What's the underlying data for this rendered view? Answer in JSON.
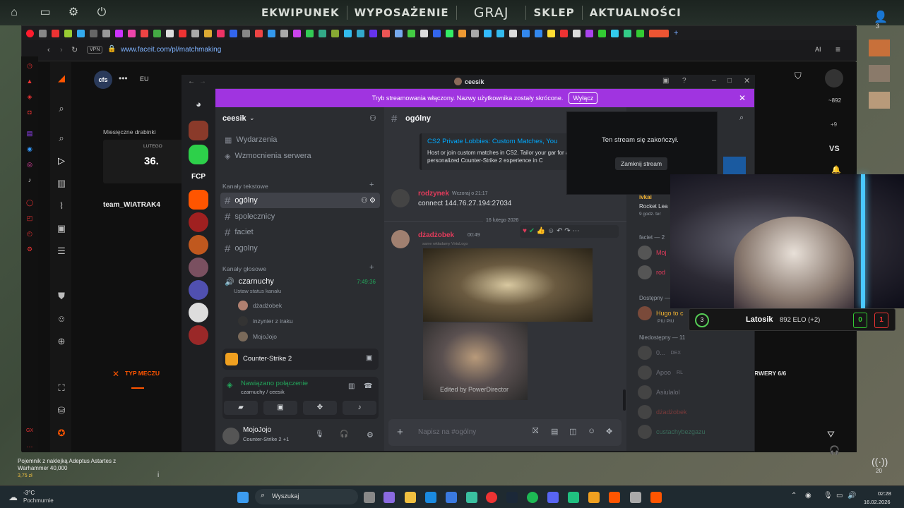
{
  "game_menu": {
    "items": [
      "EKWIPUNEK",
      "WYPOSAŻENIE",
      "GRAJ",
      "SKLEP",
      "AKTUALNOŚCI"
    ],
    "user_count": "3"
  },
  "browser": {
    "url": "www.faceit.com/pl/matchmaking",
    "vpn_label": "VPN",
    "ai_label": "AI"
  },
  "faceit": {
    "region": "EU",
    "monthly_ladder": "Miesięczne drabinki",
    "month": "LUTEGO",
    "rank": "36.",
    "team_name": "team_WIATRAK4",
    "match_type_label": "TYP MECZU",
    "server_text": "RWERY 6/6",
    "elo_side": "~892",
    "elo_plus": "+9",
    "vs_label": "VS",
    "fcp_label": "FCP"
  },
  "discord": {
    "window_title": "ceesik",
    "banner_text": "Tryb streamowania włączony. Nazwy użytkownika zostały skrócone.",
    "banner_button": "Wyłącz",
    "server_name": "ceesik",
    "menu_items": [
      "Wydarzenia",
      "Wzmocnienia serwera"
    ],
    "text_category": "Kanały tekstowe",
    "text_channels": [
      "ogólny",
      "spolecznicy",
      "faciet",
      "ogolny"
    ],
    "voice_category": "Kanały głosowe",
    "voice_channel": "czarnuchy",
    "voice_time": "7:49:36",
    "voice_status": "Ustaw status kanału",
    "voice_users": [
      "dżadżobek",
      "inzynier z iraku",
      "MojoJojo"
    ],
    "activity_game": "Counter-Strike 2",
    "connection_status": "Nawiązano połączenie",
    "connection_sub": "czarnuchy / ceesik",
    "user_name": "MojoJojo",
    "user_status": "Counter-Strike 2 +1",
    "chat_channel": "ogólny",
    "link_embed_title": "CS2 Private Lobbies: Custom Matches, You",
    "link_embed_desc": "Host or join custom matches in CS2. Tailor your gar for a personalized Counter-Strike 2 experience in C",
    "msg1_author": "rodzynek",
    "msg1_time": "Wczoraj o 21:17",
    "msg1_text": "connect 144.76.27.194:27034",
    "date_divider": "16 lutego 2026",
    "msg2_author": "dżadżobek",
    "msg2_time": "00:49",
    "msg2_reply": "same wkładamy VirtuLogo",
    "watermark": "Edited by PowerDirector",
    "chat_placeholder": "Napisz na #ogólny",
    "stream_ended": "Ten stream się zakończył.",
    "close_stream": "Zamknij stream",
    "members": {
      "activity_name": "ivkai",
      "activity_game": "Rocket Lea",
      "activity_time": "9 godz. ter",
      "faciet_header": "faciet — 2",
      "faciet_members": [
        "Moj",
        "rod"
      ],
      "available_header": "Dostępny —",
      "available_member": "Hugo to c",
      "available_sub": "PIU PIU",
      "offline_header": "Niedostępny — 11",
      "offline_members": [
        "0...",
        "Apoo",
        "Asiulalol",
        "dżadżobek",
        "custachybezgazu"
      ],
      "offline_tags": [
        "DEX",
        "RL"
      ]
    }
  },
  "elo": {
    "level": "3",
    "name": "Latosik",
    "elo_text": "892 ELO (+2)",
    "score_win": "0",
    "score_loss": "1"
  },
  "notification": {
    "title": "Pojemnik z naklejką Adeptus Astartes z Warhammer 40,000",
    "price": "3,75 zł"
  },
  "taskbar": {
    "temp": "-3°C",
    "weather": "Pochmurnie",
    "search": "Wyszukaj",
    "time": "02:28",
    "date": "16.02.2026",
    "wifi_num": "20"
  },
  "colors": {
    "discord_purple": "#a034e0",
    "faceit_orange": "#ff5500",
    "online_green": "#23a55a",
    "link_blue": "#00a8fc"
  }
}
